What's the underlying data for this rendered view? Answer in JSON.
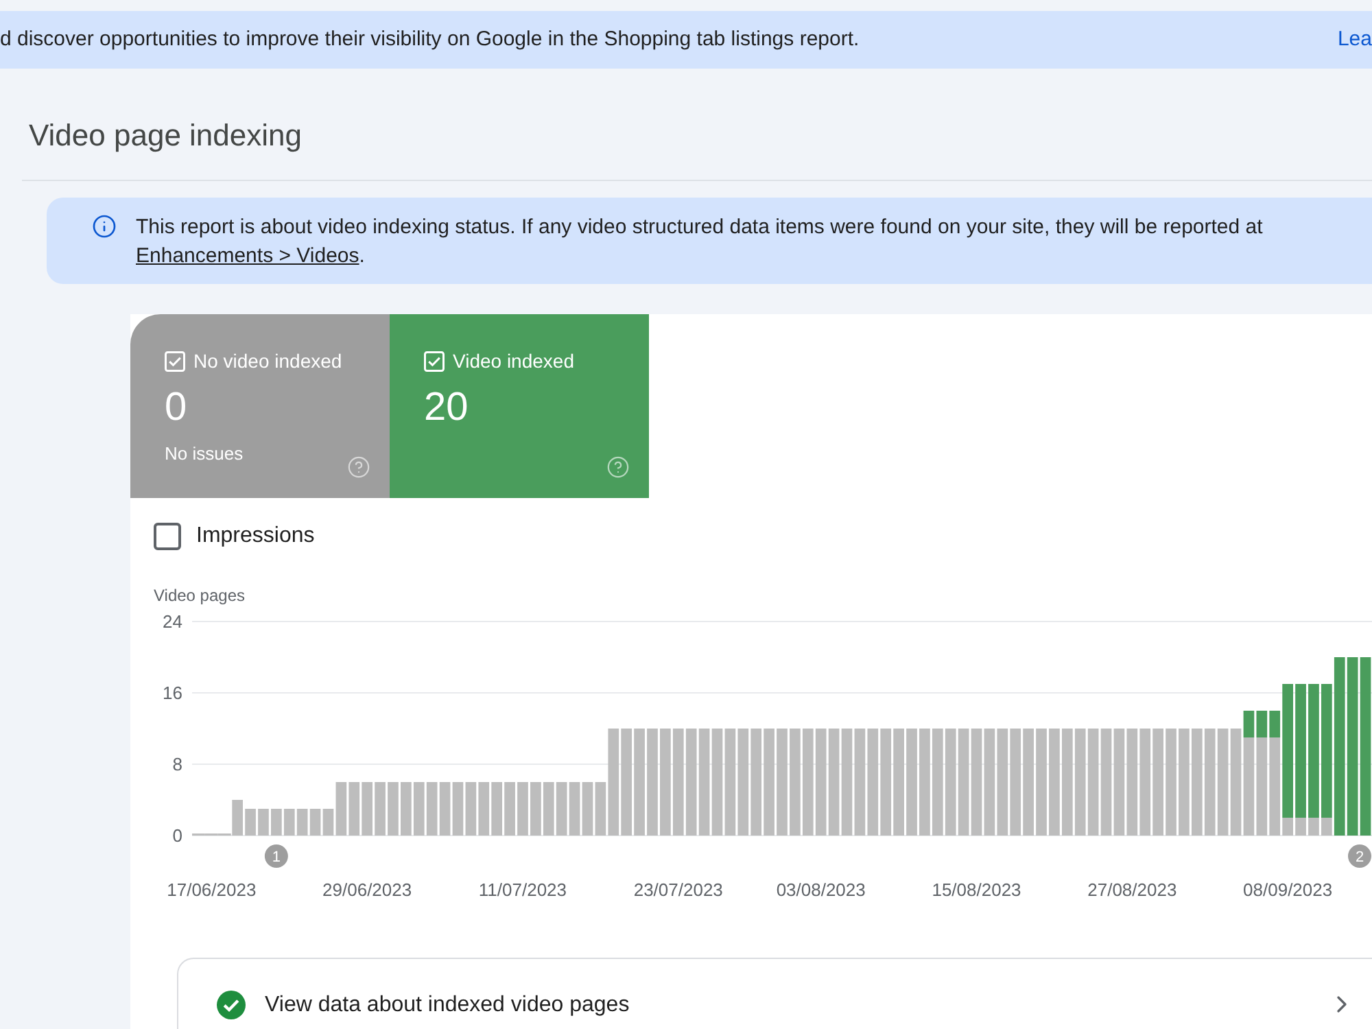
{
  "banner": {
    "text": "d discover opportunities to improve their visibility on Google in the Shopping tab listings report.",
    "link": "Lea"
  },
  "page_title": "Video page indexing",
  "info": {
    "text": "This report is about video indexing status. If any video structured data items were found on your site, they will be reported at",
    "link": "Enhancements > Videos",
    "suffix": "."
  },
  "summary_cards": [
    {
      "label": "No video indexed",
      "checked": true,
      "value": "0",
      "note": "No issues",
      "color": "#9e9e9e"
    },
    {
      "label": "Video indexed",
      "checked": true,
      "value": "20",
      "color": "#4a9d5c"
    }
  ],
  "impressions": {
    "label": "Impressions",
    "checked": false
  },
  "chart": {
    "chart_data": {
      "type": "bar",
      "stacked": true,
      "ylabel": "Video pages",
      "ylim": [
        0,
        24
      ],
      "yticks": [
        0,
        8,
        16,
        24
      ],
      "grid": true,
      "categories": [
        null,
        "17/06/2023",
        null,
        null,
        null,
        null,
        null,
        null,
        null,
        null,
        null,
        null,
        null,
        "29/06/2023",
        null,
        null,
        null,
        null,
        null,
        null,
        null,
        null,
        null,
        null,
        null,
        "11/07/2023",
        null,
        null,
        null,
        null,
        null,
        null,
        null,
        null,
        null,
        null,
        null,
        "23/07/2023",
        null,
        null,
        null,
        null,
        null,
        null,
        null,
        null,
        null,
        null,
        "03/08/2023",
        null,
        null,
        null,
        null,
        null,
        null,
        null,
        null,
        null,
        null,
        null,
        "15/08/2023",
        null,
        null,
        null,
        null,
        null,
        null,
        null,
        null,
        null,
        null,
        null,
        "27/08/2023",
        null,
        null,
        null,
        null,
        null,
        null,
        null,
        null,
        null,
        null,
        null,
        "08/09/2023",
        null,
        null,
        null,
        null,
        null,
        null
      ],
      "series": [
        {
          "color": "#bdbdbd",
          "values": [
            0,
            0,
            0,
            4,
            3,
            3,
            3,
            3,
            3,
            3,
            3,
            6,
            6,
            6,
            6,
            6,
            6,
            6,
            6,
            6,
            6,
            6,
            6,
            6,
            6,
            6,
            6,
            6,
            6,
            6,
            6,
            6,
            12,
            12,
            12,
            12,
            12,
            12,
            12,
            12,
            12,
            12,
            12,
            12,
            12,
            12,
            12,
            12,
            12,
            12,
            12,
            12,
            12,
            12,
            12,
            12,
            12,
            12,
            12,
            12,
            12,
            12,
            12,
            12,
            12,
            12,
            12,
            12,
            12,
            12,
            12,
            12,
            12,
            12,
            12,
            12,
            12,
            12,
            12,
            12,
            12,
            11,
            11,
            11,
            2,
            2,
            2,
            2,
            0,
            0,
            0
          ]
        },
        {
          "color": "#4a9d5c",
          "values": [
            0,
            0,
            0,
            0,
            0,
            0,
            0,
            0,
            0,
            0,
            0,
            0,
            0,
            0,
            0,
            0,
            0,
            0,
            0,
            0,
            0,
            0,
            0,
            0,
            0,
            0,
            0,
            0,
            0,
            0,
            0,
            0,
            0,
            0,
            0,
            0,
            0,
            0,
            0,
            0,
            0,
            0,
            0,
            0,
            0,
            0,
            0,
            0,
            0,
            0,
            0,
            0,
            0,
            0,
            0,
            0,
            0,
            0,
            0,
            0,
            0,
            0,
            0,
            0,
            0,
            0,
            0,
            0,
            0,
            0,
            0,
            0,
            0,
            0,
            0,
            0,
            0,
            0,
            0,
            0,
            0,
            3,
            3,
            3,
            15,
            15,
            15,
            15,
            20,
            20,
            20
          ]
        }
      ],
      "annotations": [
        "1",
        "2"
      ]
    }
  },
  "link_row": {
    "label": "View data about indexed video pages"
  }
}
